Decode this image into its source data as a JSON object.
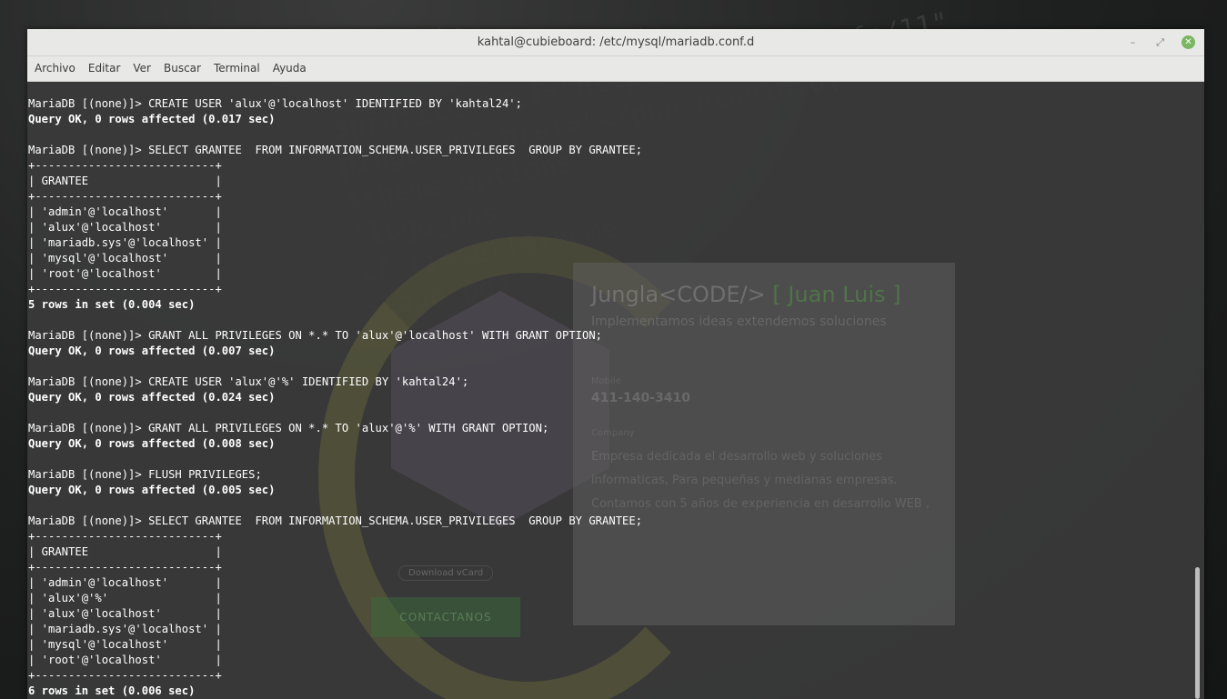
{
  "window": {
    "title": "kahtal@cubieboard: /etc/mysql/mariadb.conf.d",
    "min_icon": "minimize-icon",
    "max_icon": "maximize-icon",
    "close_icon": "close-icon",
    "close_color": "#7bb661"
  },
  "menubar": {
    "items": [
      "Archivo",
      "Editar",
      "Ver",
      "Buscar",
      "Terminal",
      "Ayuda"
    ]
  },
  "background_site": {
    "brand": "Jungla<CODE/>",
    "brand_accent": "[ Juan Luis ]",
    "tagline": "Implementamos ideas extendemos soluciones",
    "label_mobile": "Mobile",
    "phone": "411-140-3410",
    "label_company": "Company",
    "desc_lines": [
      "Empresa dedicada el desarrollo web y soluciones",
      "informaticas, Para pequeñas y medianas empresas.",
      "Contamos con 5 años de experiencia en desarrollo WEB ,"
    ],
    "vcard": "Download vCard",
    "cta": "CONTACTANOS"
  },
  "terminal": {
    "lines": [
      {
        "text": "MariaDB [(none)]> CREATE USER 'alux'@'localhost' IDENTIFIED BY 'kahtal24';",
        "bold": false
      },
      {
        "text": "Query OK, 0 rows affected (0.017 sec)",
        "bold": true
      },
      {
        "text": "",
        "bold": false
      },
      {
        "text": "MariaDB [(none)]> SELECT GRANTEE  FROM INFORMATION_SCHEMA.USER_PRIVILEGES  GROUP BY GRANTEE;",
        "bold": false
      },
      {
        "text": "+---------------------------+",
        "bold": false
      },
      {
        "text": "| GRANTEE                   |",
        "bold": false
      },
      {
        "text": "+---------------------------+",
        "bold": false
      },
      {
        "text": "| 'admin'@'localhost'       |",
        "bold": false
      },
      {
        "text": "| 'alux'@'localhost'        |",
        "bold": false
      },
      {
        "text": "| 'mariadb.sys'@'localhost' |",
        "bold": false
      },
      {
        "text": "| 'mysql'@'localhost'       |",
        "bold": false
      },
      {
        "text": "| 'root'@'localhost'        |",
        "bold": false
      },
      {
        "text": "+---------------------------+",
        "bold": false
      },
      {
        "text": "5 rows in set (0.004 sec)",
        "bold": true
      },
      {
        "text": "",
        "bold": false
      },
      {
        "text": "MariaDB [(none)]> GRANT ALL PRIVILEGES ON *.* TO 'alux'@'localhost' WITH GRANT OPTION;",
        "bold": false
      },
      {
        "text": "Query OK, 0 rows affected (0.007 sec)",
        "bold": true
      },
      {
        "text": "",
        "bold": false
      },
      {
        "text": "MariaDB [(none)]> CREATE USER 'alux'@'%' IDENTIFIED BY 'kahtal24';",
        "bold": false
      },
      {
        "text": "Query OK, 0 rows affected (0.024 sec)",
        "bold": true
      },
      {
        "text": "",
        "bold": false
      },
      {
        "text": "MariaDB [(none)]> GRANT ALL PRIVILEGES ON *.* TO 'alux'@'%' WITH GRANT OPTION;",
        "bold": false
      },
      {
        "text": "Query OK, 0 rows affected (0.008 sec)",
        "bold": true
      },
      {
        "text": "",
        "bold": false
      },
      {
        "text": "MariaDB [(none)]> FLUSH PRIVILEGES;",
        "bold": false
      },
      {
        "text": "Query OK, 0 rows affected (0.005 sec)",
        "bold": true
      },
      {
        "text": "",
        "bold": false
      },
      {
        "text": "MariaDB [(none)]> SELECT GRANTEE  FROM INFORMATION_SCHEMA.USER_PRIVILEGES  GROUP BY GRANTEE;",
        "bold": false
      },
      {
        "text": "+---------------------------+",
        "bold": false
      },
      {
        "text": "| GRANTEE                   |",
        "bold": false
      },
      {
        "text": "+---------------------------+",
        "bold": false
      },
      {
        "text": "| 'admin'@'localhost'       |",
        "bold": false
      },
      {
        "text": "| 'alux'@'%'                |",
        "bold": false
      },
      {
        "text": "| 'alux'@'localhost'        |",
        "bold": false
      },
      {
        "text": "| 'mariadb.sys'@'localhost' |",
        "bold": false
      },
      {
        "text": "| 'mysql'@'localhost'       |",
        "bold": false
      },
      {
        "text": "| 'root'@'localhost'        |",
        "bold": false
      },
      {
        "text": "+---------------------------+",
        "bold": false
      },
      {
        "text": "6 rows in set (0.006 sec)",
        "bold": true
      }
    ]
  }
}
